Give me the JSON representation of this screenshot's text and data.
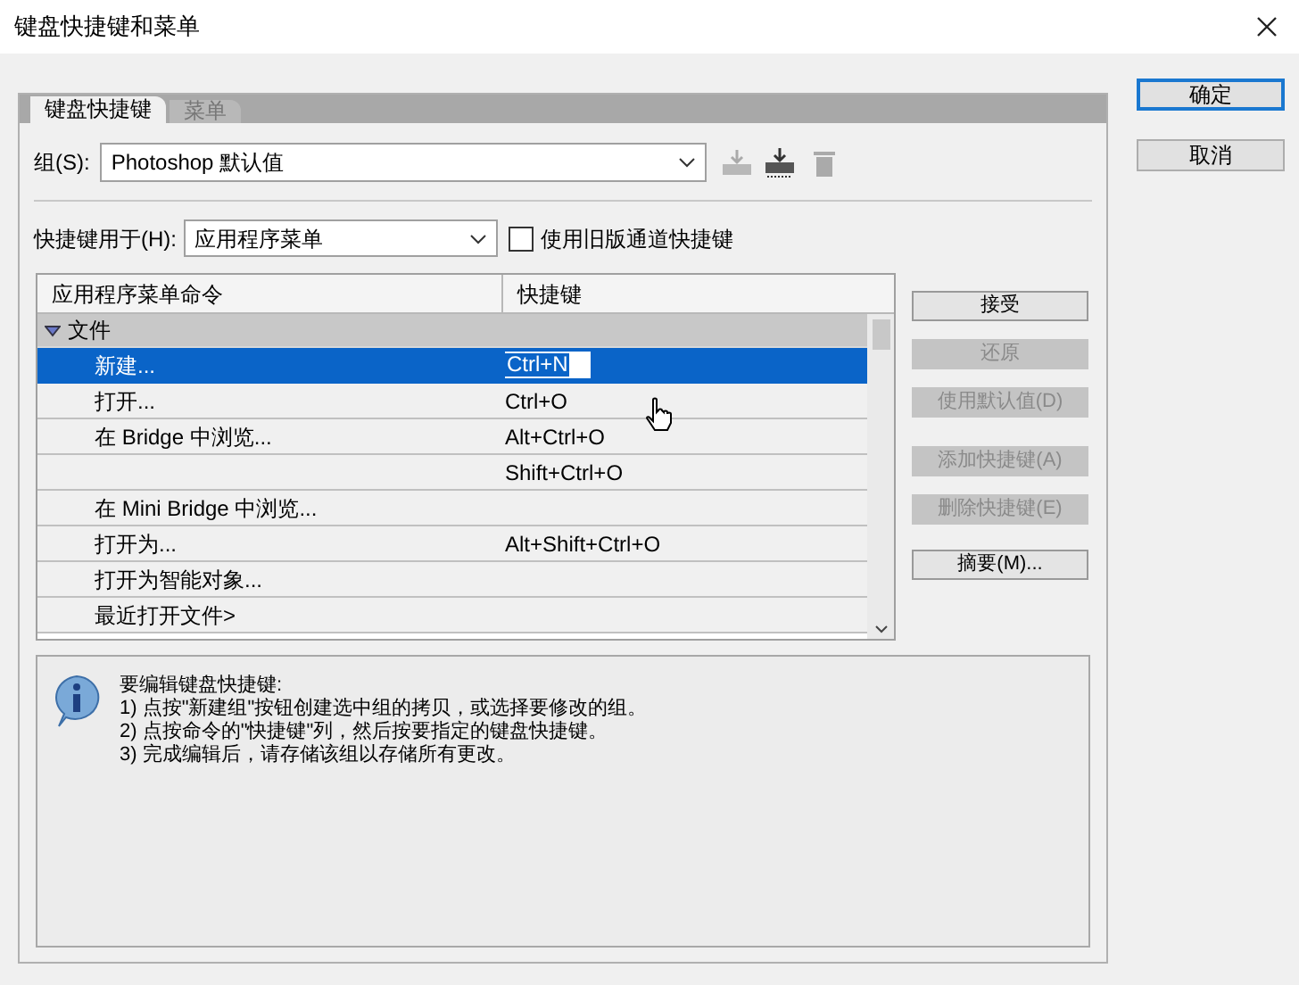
{
  "window": {
    "title": "键盘快捷键和菜单"
  },
  "tabs": [
    {
      "label": "键盘快捷键",
      "selected": true
    },
    {
      "label": "菜单",
      "selected": false
    }
  ],
  "group": {
    "label": "组(S):",
    "value": "Photoshop 默认值"
  },
  "shortcuts_for": {
    "label": "快捷键用于(H):",
    "value": "应用程序菜单"
  },
  "legacy_checkbox": {
    "label": "使用旧版通道快捷键",
    "checked": false
  },
  "table": {
    "columns": [
      "应用程序菜单命令",
      "快捷键"
    ],
    "rows": [
      {
        "kind": "group",
        "command": "文件",
        "expanded": true
      },
      {
        "kind": "item",
        "command": "新建...",
        "shortcut": "Ctrl+N",
        "selected": true
      },
      {
        "kind": "item",
        "command": "打开...",
        "shortcut": "Ctrl+O",
        "selected": false
      },
      {
        "kind": "item",
        "command": "在 Bridge 中浏览...",
        "shortcut": "Alt+Ctrl+O",
        "selected": false
      },
      {
        "kind": "item",
        "shortcut": "Shift+Ctrl+O",
        "selected": false
      },
      {
        "kind": "item",
        "command": "在 Mini Bridge 中浏览...",
        "selected": false
      },
      {
        "kind": "item",
        "command": "打开为...",
        "shortcut": "Alt+Shift+Ctrl+O",
        "selected": false
      },
      {
        "kind": "item",
        "command": "打开为智能对象...",
        "selected": false
      },
      {
        "kind": "item",
        "command": "最近打开文件>",
        "selected": false
      }
    ]
  },
  "side_buttons": [
    {
      "label": "接受",
      "disabled": false
    },
    {
      "label": "还原",
      "disabled": true
    },
    {
      "label": "使用默认值(D)",
      "disabled": true
    },
    {
      "label": "添加快捷键(A)",
      "disabled": true
    },
    {
      "label": "删除快捷键(E)",
      "disabled": true
    },
    {
      "label": "摘要(M)...",
      "disabled": false
    }
  ],
  "info": [
    "要编辑键盘快捷键:",
    "1) 点按\"新建组\"按钮创建选中组的拷贝，或选择要修改的组。",
    "2) 点按命令的\"快捷键\"列，然后按要指定的键盘快捷键。",
    "3) 完成编辑后，请存储该组以存储所有更改。"
  ],
  "dialog_buttons": [
    {
      "label": "确定",
      "default": true
    },
    {
      "label": "取消",
      "default": false
    }
  ]
}
